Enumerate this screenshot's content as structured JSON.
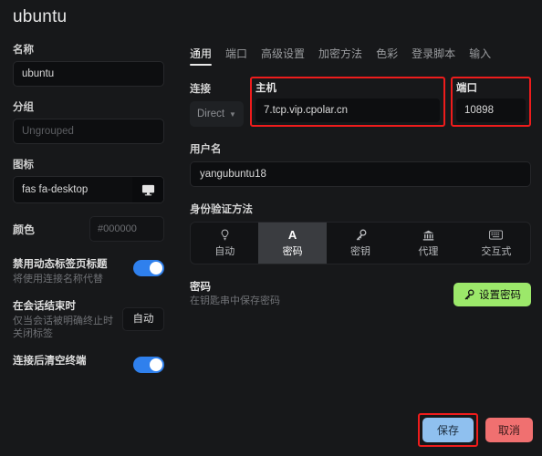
{
  "window": {
    "title": "ubuntu"
  },
  "left_panel": {
    "name": {
      "label": "名称",
      "value": "ubuntu"
    },
    "group": {
      "label": "分组",
      "placeholder": "Ungrouped"
    },
    "icon": {
      "label": "图标",
      "value": "fas fa-desktop",
      "button_icon": "desktop-icon"
    },
    "color": {
      "label": "颜色",
      "value": "#000000"
    },
    "disable_dynamic_tab_title": {
      "title": "禁用动态标签页标题",
      "subtitle": "将使用连接名称代替",
      "enabled": true
    },
    "on_session_end": {
      "title": "在会话结束时",
      "subtitle": "仅当会话被明确终止时关闭标签",
      "value": "自动"
    },
    "clear_terminal_after_connect": {
      "title": "连接后清空终端",
      "enabled": true
    }
  },
  "right_panel": {
    "tabs": [
      {
        "label": "通用",
        "active": true
      },
      {
        "label": "端口",
        "active": false
      },
      {
        "label": "高级设置",
        "active": false
      },
      {
        "label": "加密方法",
        "active": false
      },
      {
        "label": "色彩",
        "active": false
      },
      {
        "label": "登录脚本",
        "active": false
      },
      {
        "label": "输入",
        "active": false
      }
    ],
    "connection": {
      "label": "连接",
      "proxy": {
        "value": "Direct",
        "caret": "chevron-down-icon"
      },
      "host": {
        "label": "主机",
        "value": "7.tcp.vip.cpolar.cn",
        "highlighted": true
      },
      "port": {
        "label": "端口",
        "value": "10898",
        "highlighted": true
      }
    },
    "username": {
      "label": "用户名",
      "value": "yangubuntu18"
    },
    "auth": {
      "label": "身份验证方法",
      "options": [
        {
          "label": "自动",
          "icon": "lightbulb-icon",
          "glyph": "Ὂ1",
          "active": false
        },
        {
          "label": "密码",
          "icon": "letter-a-icon",
          "glyph": "A",
          "active": true
        },
        {
          "label": "密钥",
          "icon": "key-icon",
          "glyph": "⚿",
          "active": false
        },
        {
          "label": "代理",
          "icon": "bank-icon",
          "glyph": "ἽB",
          "active": false
        },
        {
          "label": "交互式",
          "icon": "keyboard-icon",
          "glyph": "⌨",
          "active": false
        }
      ]
    },
    "password": {
      "title": "密码",
      "subtitle": "在钥匙串中保存密码",
      "button_label": "设置密码",
      "button_icon": "key-icon"
    }
  },
  "footer": {
    "save": {
      "label": "保存",
      "highlighted": true
    },
    "cancel": {
      "label": "取消"
    }
  },
  "colors": {
    "background": "#17181a",
    "accent_blue": "#2f80ed",
    "highlight_red": "#ee1c1c",
    "green_button": "#9ce86a",
    "save_button": "#8fc0ef",
    "cancel_button": "#f07070"
  }
}
